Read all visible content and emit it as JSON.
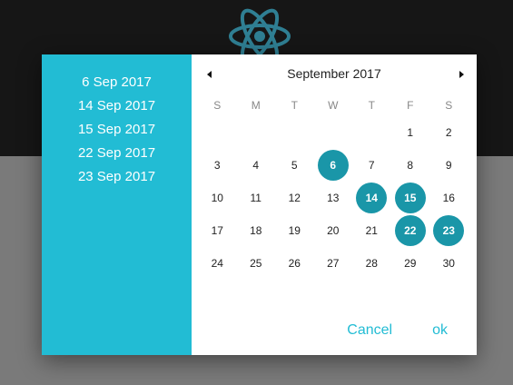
{
  "colors": {
    "accent": "#22bcd4",
    "selected_day": "#1a96a8",
    "backdrop_top": "#161616",
    "backdrop_bottom": "#7a7a7a"
  },
  "logo": {
    "icon": "react-atom-icon"
  },
  "selected_dates": [
    "6 Sep 2017",
    "14 Sep 2017",
    "15 Sep 2017",
    "22 Sep 2017",
    "23 Sep 2017"
  ],
  "calendar": {
    "month_title": "September 2017",
    "prev_icon": "triangle-left-icon",
    "next_icon": "triangle-right-icon",
    "weekdays": [
      "S",
      "M",
      "T",
      "W",
      "T",
      "F",
      "S"
    ],
    "leading_blanks": 5,
    "days": [
      "1",
      "2",
      "3",
      "4",
      "5",
      "6",
      "7",
      "8",
      "9",
      "10",
      "11",
      "12",
      "13",
      "14",
      "15",
      "16",
      "17",
      "18",
      "19",
      "20",
      "21",
      "22",
      "23",
      "24",
      "25",
      "26",
      "27",
      "28",
      "29",
      "30"
    ],
    "selected_days": [
      "6",
      "14",
      "15",
      "22",
      "23"
    ]
  },
  "actions": {
    "cancel_label": "Cancel",
    "ok_label": "ok"
  }
}
